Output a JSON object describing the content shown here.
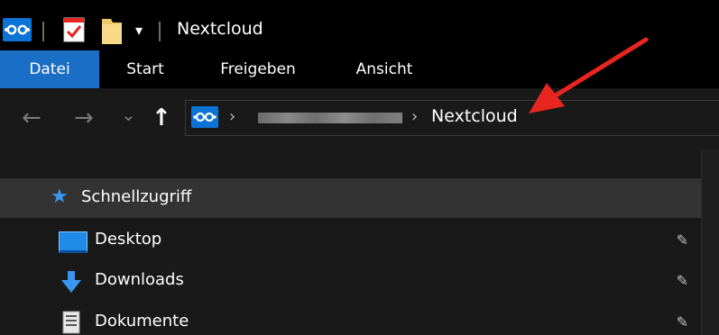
{
  "window": {
    "title": "Nextcloud",
    "quick_access_dropdown_glyph": "▾",
    "icons": [
      "nextcloud-icon",
      "properties-icon",
      "new-folder-icon",
      "customize-toolbar-icon"
    ]
  },
  "ribbon": {
    "tabs": [
      {
        "label": "Datei",
        "active": true
      },
      {
        "label": "Start"
      },
      {
        "label": "Freigeben"
      },
      {
        "label": "Ansicht"
      }
    ]
  },
  "addressbar": {
    "back_glyph": "←",
    "forward_glyph": "→",
    "recent_glyph": "⌄",
    "up_glyph": "↑",
    "separator": "›",
    "current": "Nextcloud",
    "accent": "#1a6ec5"
  },
  "navpane": {
    "items": [
      {
        "label": "Schnellzugriff",
        "icon": "star-icon",
        "selected": true,
        "pinned": false
      },
      {
        "label": "Desktop",
        "icon": "desktop-icon",
        "pinned": true
      },
      {
        "label": "Downloads",
        "icon": "download-icon",
        "pinned": true
      },
      {
        "label": "Dokumente",
        "icon": "document-icon",
        "pinned": true
      }
    ],
    "pin_glyph": "📌"
  },
  "annotation": {
    "color": "#e8251f",
    "icon": "red-arrow-icon"
  }
}
